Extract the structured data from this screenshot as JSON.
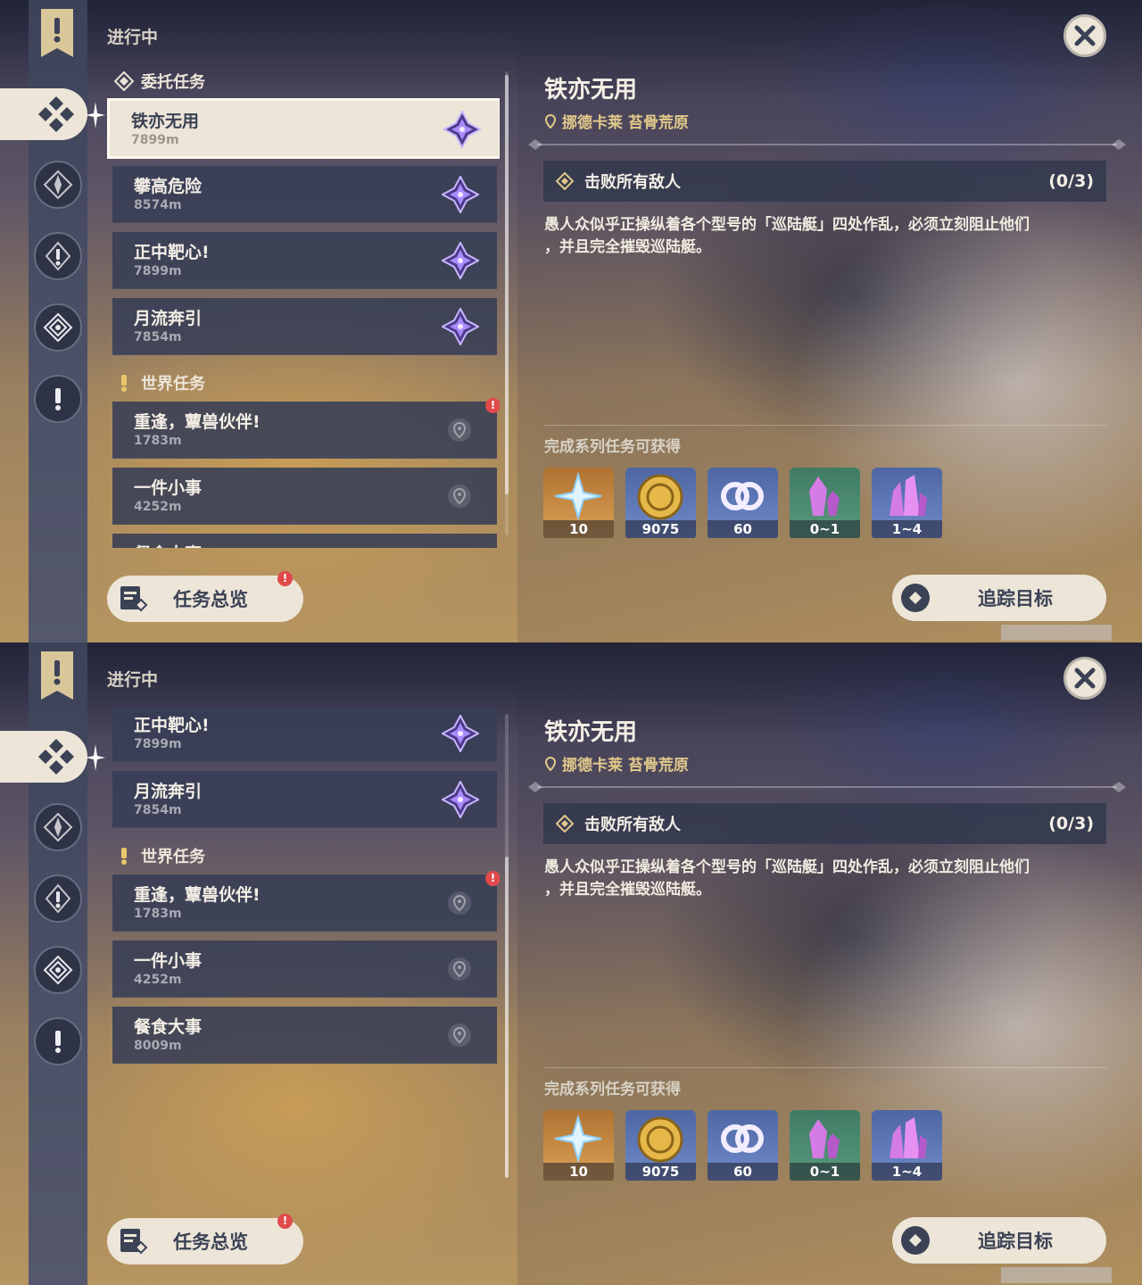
{
  "status_label": "进行中",
  "categories": {
    "commission": "委托任务",
    "world": "世界任务"
  },
  "quests": [
    {
      "name": "铁亦无用",
      "distance": "7899m"
    },
    {
      "name": "攀高危险",
      "distance": "8574m"
    },
    {
      "name": "正中靶心!",
      "distance": "7899m"
    },
    {
      "name": "月流奔引",
      "distance": "7854m"
    },
    {
      "name": "重逢，蕈兽伙伴!",
      "distance": "1783m"
    },
    {
      "name": "一件小事",
      "distance": "4252m"
    },
    {
      "name": "餐食大事",
      "distance": "8009m"
    }
  ],
  "alert_mark": "!",
  "overview_button": "任务总览",
  "detail": {
    "title": "铁亦无用",
    "location": "挪德卡莱 苔骨荒原",
    "objective": "击败所有敌人",
    "objective_count": "(0/3)",
    "description_line1": "愚人众似乎正操纵着各个型号的「巡陆艇」四处作乱，必须立刻阻止他们",
    "description_line2": "，并且完全摧毁巡陆艇。",
    "rewards_label": "完成系列任务可获得",
    "rewards": [
      {
        "icon": "primogem-icon",
        "qty": "10"
      },
      {
        "icon": "mora-icon",
        "qty": "9075"
      },
      {
        "icon": "fetters-icon",
        "qty": "60"
      },
      {
        "icon": "crystal-small-icon",
        "qty": "0~1"
      },
      {
        "icon": "crystal-large-icon",
        "qty": "1~4"
      }
    ],
    "track_button": "追踪目标"
  },
  "colors": {
    "panel": "#ece5d8",
    "dark_text": "#3b4255",
    "alert": "#e04a4a",
    "location": "#e2c98b"
  }
}
